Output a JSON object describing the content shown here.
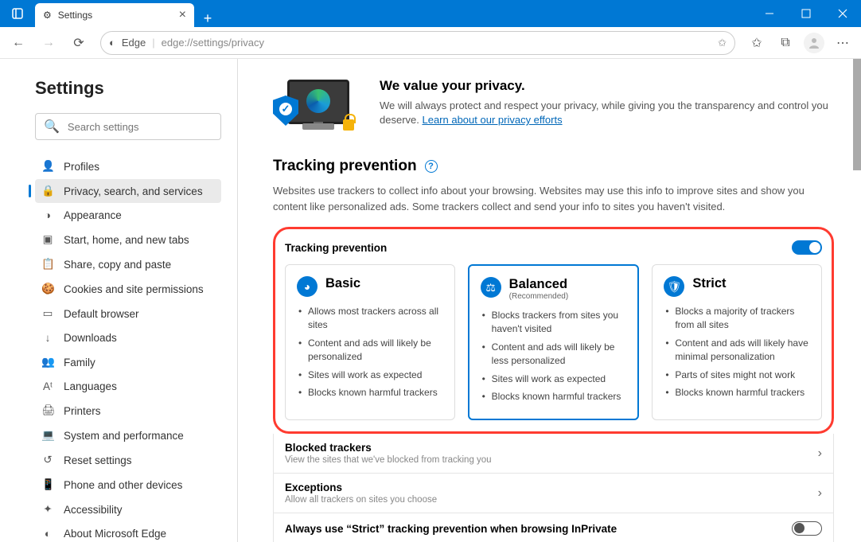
{
  "tab": {
    "title": "Settings"
  },
  "address": {
    "scheme": "Edge",
    "url": "edge://settings/privacy"
  },
  "search": {
    "placeholder": "Search settings"
  },
  "sidebar": {
    "title": "Settings",
    "items": [
      {
        "label": "Profiles"
      },
      {
        "label": "Privacy, search, and services"
      },
      {
        "label": "Appearance"
      },
      {
        "label": "Start, home, and new tabs"
      },
      {
        "label": "Share, copy and paste"
      },
      {
        "label": "Cookies and site permissions"
      },
      {
        "label": "Default browser"
      },
      {
        "label": "Downloads"
      },
      {
        "label": "Family"
      },
      {
        "label": "Languages"
      },
      {
        "label": "Printers"
      },
      {
        "label": "System and performance"
      },
      {
        "label": "Reset settings"
      },
      {
        "label": "Phone and other devices"
      },
      {
        "label": "Accessibility"
      },
      {
        "label": "About Microsoft Edge"
      }
    ]
  },
  "hero": {
    "title": "We value your privacy.",
    "body": "We will always protect and respect your privacy, while giving you the transparency and control you deserve. ",
    "link": "Learn about our privacy efforts"
  },
  "tracking": {
    "heading": "Tracking prevention",
    "desc": "Websites use trackers to collect info about your browsing. Websites may use this info to improve sites and show you content like personalized ads. Some trackers collect and send your info to sites you haven't visited.",
    "toggle_label": "Tracking prevention",
    "cards": [
      {
        "title": "Basic",
        "sub": "",
        "points": [
          "Allows most trackers across all sites",
          "Content and ads will likely be personalized",
          "Sites will work as expected",
          "Blocks known harmful trackers"
        ]
      },
      {
        "title": "Balanced",
        "sub": "(Recommended)",
        "points": [
          "Blocks trackers from sites you haven't visited",
          "Content and ads will likely be less personalized",
          "Sites will work as expected",
          "Blocks known harmful trackers"
        ]
      },
      {
        "title": "Strict",
        "sub": "",
        "points": [
          "Blocks a majority of trackers from all sites",
          "Content and ads will likely have minimal personalization",
          "Parts of sites might not work",
          "Blocks known harmful trackers"
        ]
      }
    ]
  },
  "rows": {
    "blocked": {
      "title": "Blocked trackers",
      "sub": "View the sites that we've blocked from tracking you"
    },
    "exceptions": {
      "title": "Exceptions",
      "sub": "Allow all trackers on sites you choose"
    },
    "strict": {
      "title": "Always use “Strict” tracking prevention when browsing InPrivate"
    }
  }
}
